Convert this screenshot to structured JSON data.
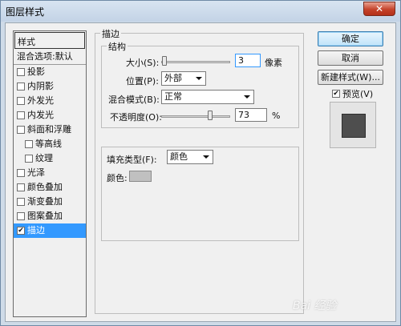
{
  "window": {
    "title": "图层样式"
  },
  "styles_list": {
    "header": "样式",
    "blending": "混合选项:默认",
    "items": [
      {
        "label": "投影",
        "checked": false,
        "indent": false
      },
      {
        "label": "内阴影",
        "checked": false,
        "indent": false
      },
      {
        "label": "外发光",
        "checked": false,
        "indent": false
      },
      {
        "label": "内发光",
        "checked": false,
        "indent": false
      },
      {
        "label": "斜面和浮雕",
        "checked": false,
        "indent": false
      },
      {
        "label": "等高线",
        "checked": false,
        "indent": true
      },
      {
        "label": "纹理",
        "checked": false,
        "indent": true
      },
      {
        "label": "光泽",
        "checked": false,
        "indent": false
      },
      {
        "label": "颜色叠加",
        "checked": false,
        "indent": false
      },
      {
        "label": "渐变叠加",
        "checked": false,
        "indent": false
      },
      {
        "label": "图案叠加",
        "checked": false,
        "indent": false
      },
      {
        "label": "描边",
        "checked": true,
        "indent": false,
        "selected": true
      }
    ]
  },
  "stroke": {
    "title": "描边",
    "structure": {
      "title": "结构",
      "size_label": "大小(S):",
      "size_value": "3",
      "size_unit": "像素",
      "size_fraction": 0.01,
      "position_label": "位置(P):",
      "position_value": "外部",
      "blend_label": "混合模式(B):",
      "blend_value": "正常",
      "opacity_label": "不透明度(O):",
      "opacity_value": "73",
      "opacity_unit": "%",
      "opacity_fraction": 0.73
    },
    "fill": {
      "type_label": "填充类型(F):",
      "type_value": "颜色",
      "color_label": "颜色:",
      "color": "#c0c0c0"
    }
  },
  "buttons": {
    "ok": "确定",
    "cancel": "取消",
    "new_style": "新建样式(W)...",
    "preview_label": "预览(V)",
    "preview_checked": true
  },
  "watermark": "Bai 经验"
}
